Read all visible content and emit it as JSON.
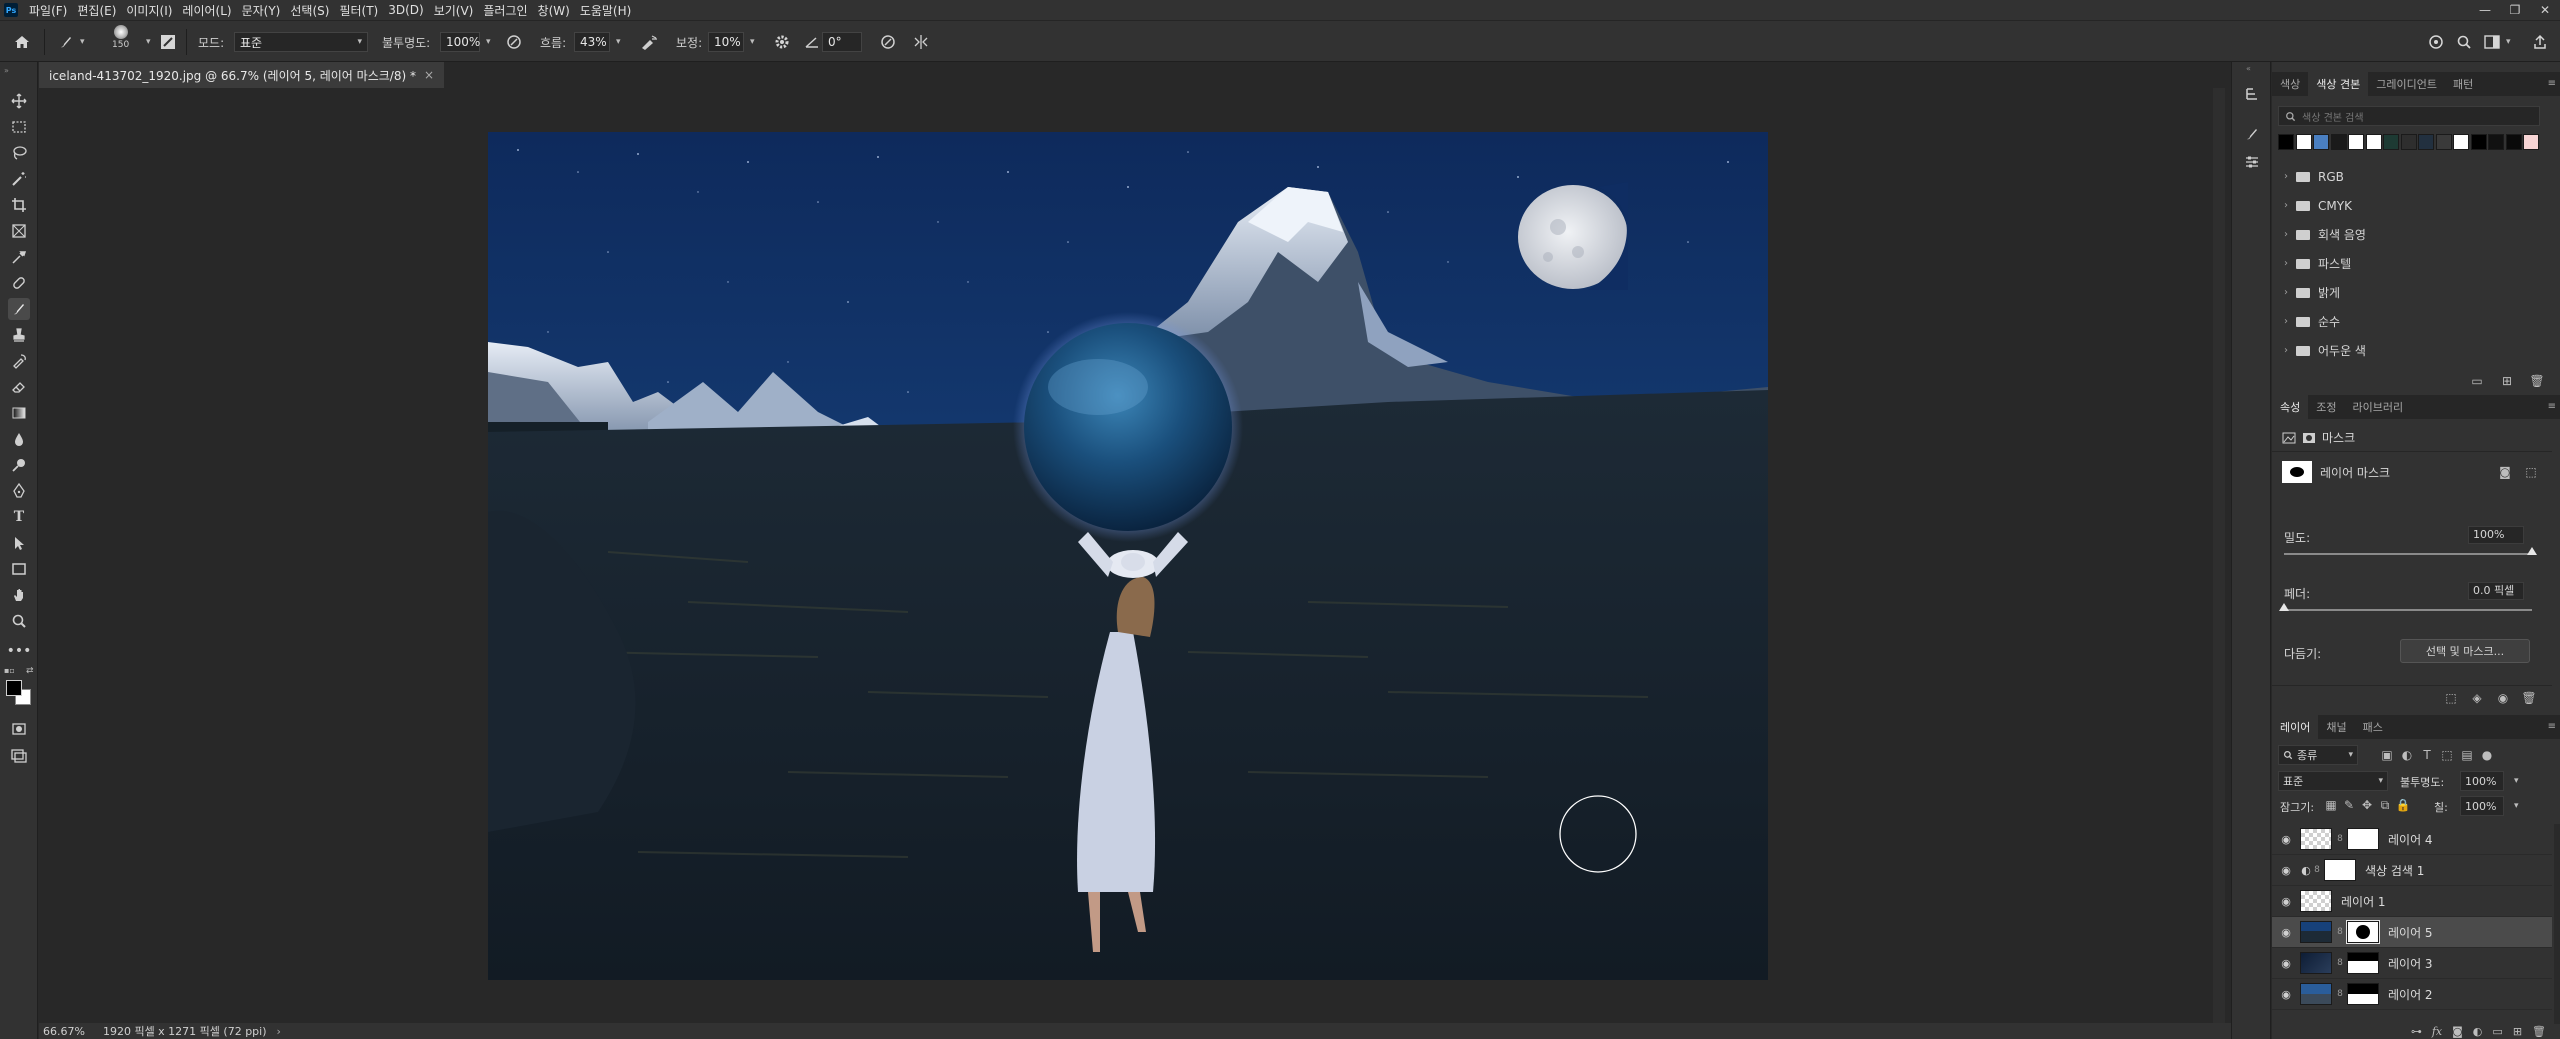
{
  "app": {
    "logo": "Ps",
    "menu": [
      "파일(F)",
      "편집(E)",
      "이미지(I)",
      "레이어(L)",
      "문자(Y)",
      "선택(S)",
      "필터(T)",
      "3D(D)",
      "보기(V)",
      "플러그인",
      "창(W)",
      "도움말(H)"
    ],
    "window_controls": [
      "minimize-icon",
      "restore-icon",
      "close-icon"
    ]
  },
  "options": {
    "brush_size": "150",
    "mode_label": "모드:",
    "mode_value": "표준",
    "opacity_label": "불투명도:",
    "opacity_value": "100%",
    "flow_label": "흐름:",
    "flow_value": "43%",
    "smoothing_label": "보정:",
    "smoothing_value": "10%",
    "angle_value": "0°"
  },
  "document": {
    "tab_title": "iceland-413702_1920.jpg @ 66.7% (레이어 5, 레이어 마스크/8) *",
    "tab_close": "×"
  },
  "status": {
    "zoom": "66.67%",
    "info": "1920 픽셀 x 1271 픽셀 (72 ppi)",
    "arrow": "›"
  },
  "swatches_panel": {
    "tabs": [
      "색상",
      "색상 견본",
      "그레이디언트",
      "패턴"
    ],
    "active_tab": 1,
    "search_placeholder": "색상 견본 검색",
    "colors": [
      "#000000",
      "#ffffff",
      "#4a7fc1",
      "#1a1a1a",
      "#ffffff",
      "#ffffff",
      "#1d3a33",
      "#2e2e2e",
      "#22303f",
      "#3a3a3a",
      "#ffffff",
      "#000000",
      "#111111",
      "#0a0a0a",
      "#f6d4d4"
    ],
    "folders": [
      "RGB",
      "CMYK",
      "회색 음영",
      "파스텔",
      "밝게",
      "순수",
      "어두운 색"
    ]
  },
  "properties_panel": {
    "tabs": [
      "속성",
      "조정",
      "라이브러리"
    ],
    "active_tab": 0,
    "header": "마스크",
    "mask_title": "레이어 마스크",
    "density_label": "밀도:",
    "density_value": "100%",
    "density_level": 1.0,
    "feather_label": "페더:",
    "feather_value": "0.0 픽셀",
    "feather_level": 0.0,
    "refine_label": "다듬기:",
    "refine_button": "선택 및 마스크..."
  },
  "layers_panel": {
    "tabs": [
      "레이어",
      "채널",
      "패스"
    ],
    "active_tab": 0,
    "filter_value": "종류",
    "blend_value": "표준",
    "opacity_label": "불투명도:",
    "opacity_value": "100%",
    "lock_label": "잠그기:",
    "fill_label": "칠:",
    "fill_value": "100%",
    "layers": [
      {
        "name": "레이어 4",
        "selected": false
      },
      {
        "name": "색상 검색 1",
        "selected": false
      },
      {
        "name": "레이어 1",
        "selected": false
      },
      {
        "name": "레이어 5",
        "selected": true
      },
      {
        "name": "레이어 3",
        "selected": false
      },
      {
        "name": "레이어 2",
        "selected": false
      }
    ],
    "footer_icons": [
      "link-icon",
      "fx-icon",
      "mask-icon",
      "adjustment-icon",
      "group-icon",
      "new-layer-icon",
      "trash-icon"
    ]
  }
}
